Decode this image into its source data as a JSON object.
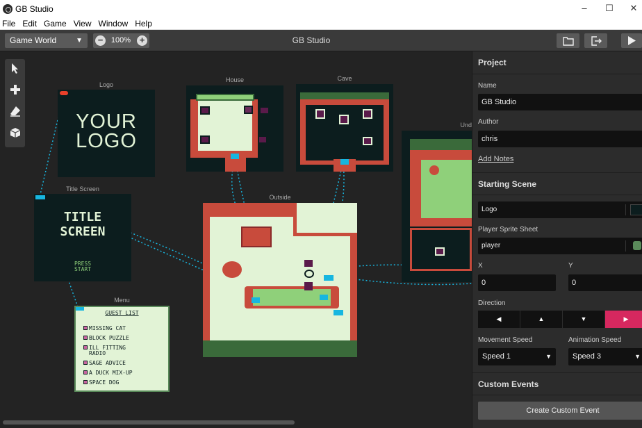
{
  "window": {
    "title": "GB Studio",
    "minimize": "–",
    "maximize": "☐",
    "close": "✕"
  },
  "menu": [
    "File",
    "Edit",
    "Game",
    "View",
    "Window",
    "Help"
  ],
  "toolbar": {
    "world_select": "Game World",
    "zoom_value": "100%",
    "zoom_out": "−",
    "zoom_in": "+",
    "title": "GB Studio"
  },
  "canvas": {
    "tools": [
      "select-tool",
      "add-tool",
      "eraser-tool",
      "actor-tool"
    ],
    "scenes": {
      "logo": {
        "label": "Logo",
        "text_line1": "YOUR",
        "text_line2": "LOGO"
      },
      "title_screen": {
        "label": "Title Screen",
        "text_line1": "TITLE",
        "text_line2": "SCREEN",
        "press1": "PRESS",
        "press2": "START"
      },
      "menu": {
        "label": "Menu",
        "heading": "GUEST LIST",
        "items": [
          "MISSING CAT",
          "BLOCK PUZZLE",
          "ILL FITTING",
          "RADIO",
          "SAGE ADVICE",
          "A DUCK MIX-UP",
          "SPACE DOG"
        ]
      },
      "house": {
        "label": "House"
      },
      "cave": {
        "label": "Cave"
      },
      "outside": {
        "label": "Outside"
      },
      "underground": {
        "label": "Und"
      }
    }
  },
  "panel": {
    "project_heading": "Project",
    "name_label": "Name",
    "name_value": "GB Studio",
    "author_label": "Author",
    "author_value": "chris",
    "add_notes": "Add Notes",
    "starting_scene_heading": "Starting Scene",
    "scene_value": "Logo",
    "player_sprite_label": "Player Sprite Sheet",
    "player_sprite_value": "player",
    "x_label": "X",
    "x_value": "0",
    "y_label": "Y",
    "y_value": "0",
    "direction_label": "Direction",
    "directions": [
      "◀",
      "▲",
      "▼",
      "▶"
    ],
    "movement_speed_label": "Movement Speed",
    "movement_speed_value": "Speed 1",
    "animation_speed_label": "Animation Speed",
    "animation_speed_value": "Speed 3",
    "custom_events_heading": "Custom Events",
    "create_custom_event": "Create Custom Event"
  },
  "colors": {
    "accent_direction": "#d6285f",
    "connector": "#17b6e0",
    "gb_light": "#e2f3d6",
    "gb_dark": "#0c1d1e",
    "brick": "#c84b3c"
  }
}
